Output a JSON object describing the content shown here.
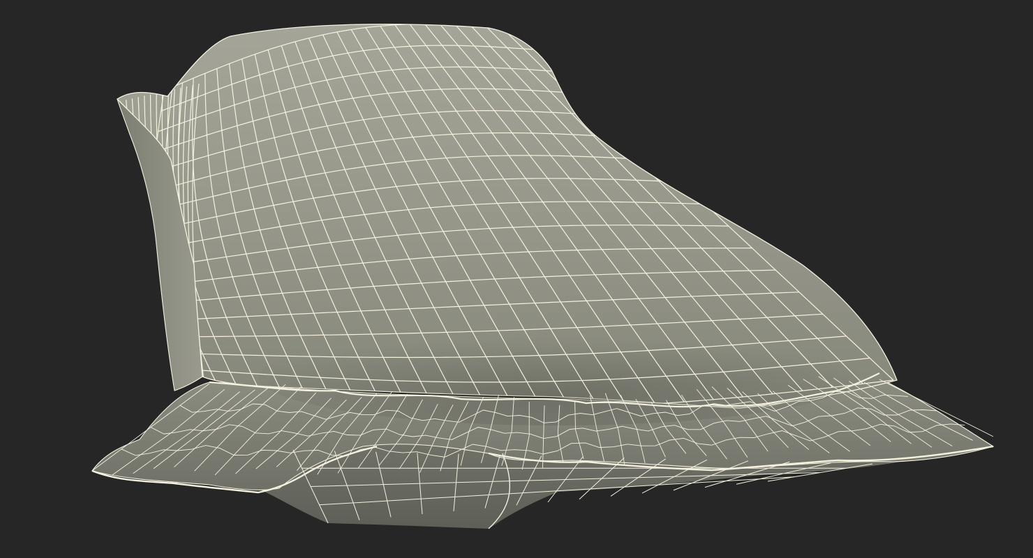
{
  "scene": {
    "subject": "wireframe-pillow",
    "colors": {
      "background": "#262626",
      "surface_light": "#a9aa9e",
      "surface_mid": "#8e8f83",
      "surface_dark": "#5f6058",
      "wire": "#f4f1df"
    }
  }
}
